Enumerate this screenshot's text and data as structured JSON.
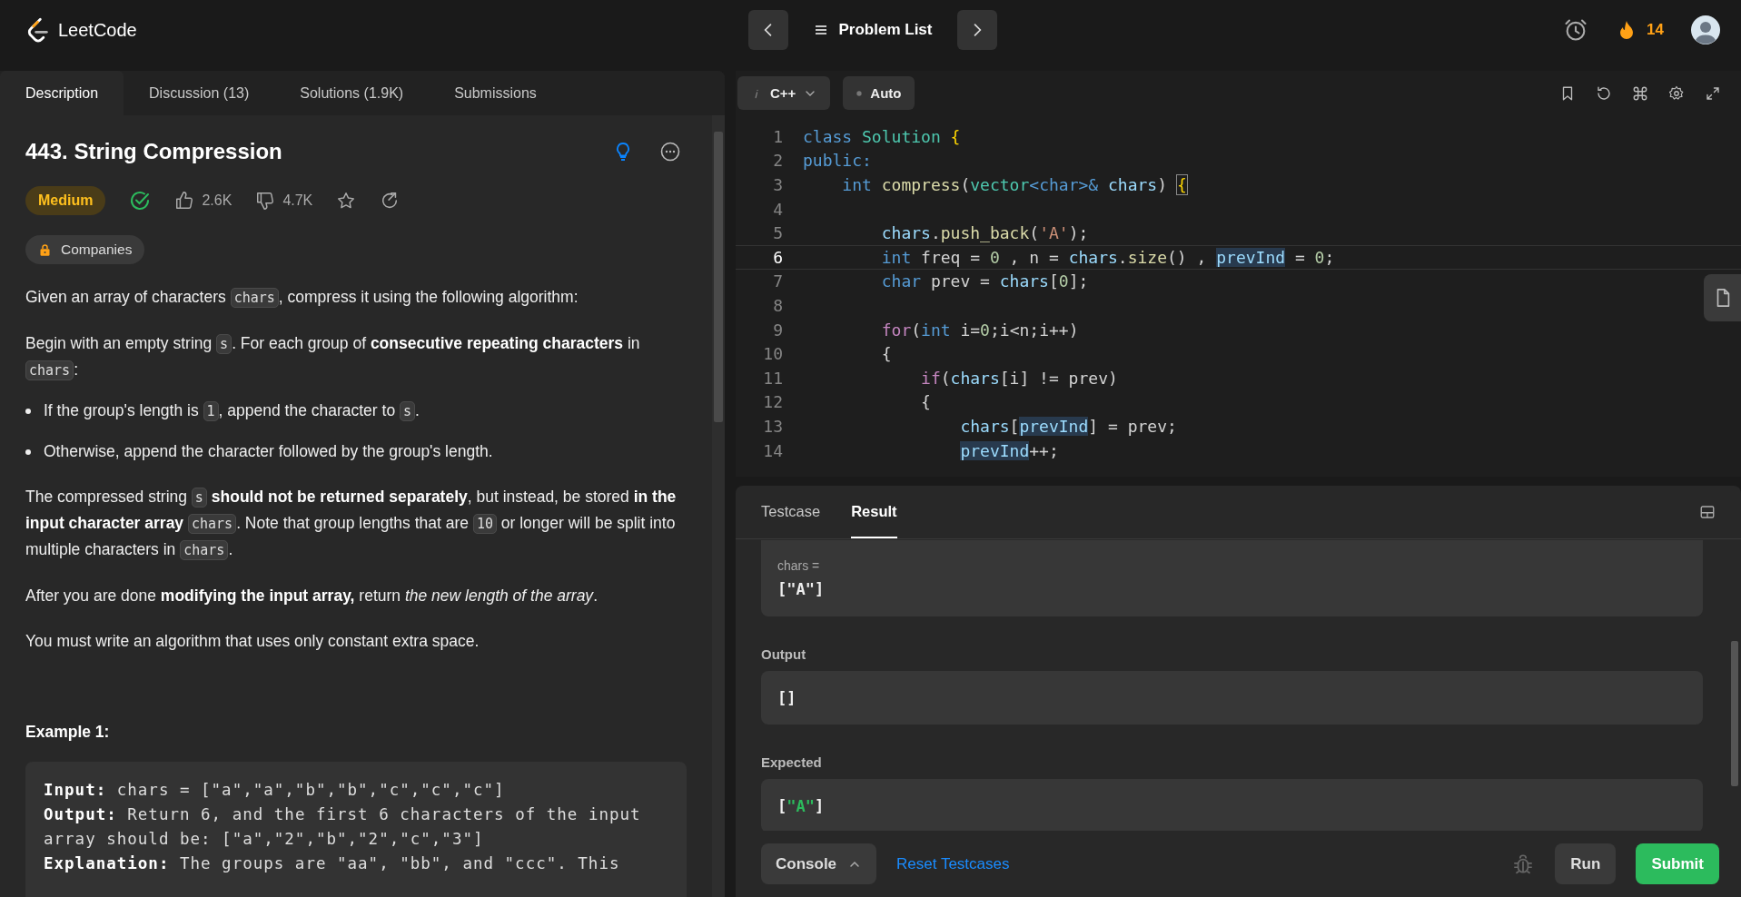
{
  "top_bar": {
    "logo": "LeetCode",
    "problem_list": "Problem List",
    "streak": "14"
  },
  "tabs": [
    {
      "label": "Description",
      "selected": true
    },
    {
      "label": "Discussion (13)",
      "selected": false
    },
    {
      "label": "Solutions (1.9K)",
      "selected": false
    },
    {
      "label": "Submissions",
      "selected": false
    }
  ],
  "problem": {
    "title": "443. String Compression",
    "difficulty": "Medium",
    "solved": true,
    "likes": "2.6K",
    "dislikes": "4.7K",
    "companies": "Companies",
    "description": [
      {
        "kind": "paragraph",
        "parts": [
          {
            "kind": "text",
            "text": "Given an array of characters "
          },
          {
            "kind": "code",
            "text": "chars"
          },
          {
            "kind": "text",
            "text": ", compress it using the following algorithm:"
          }
        ]
      },
      {
        "kind": "paragraph",
        "parts": [
          {
            "kind": "text",
            "text": "Begin with an empty string "
          },
          {
            "kind": "code",
            "text": "s"
          },
          {
            "kind": "text",
            "text": ". For each group of **consecutive repeating characters** in "
          },
          {
            "kind": "code",
            "text": "chars"
          },
          {
            "kind": "text",
            "text": ":"
          }
        ]
      },
      {
        "kind": "bullet",
        "parts": [
          {
            "kind": "text",
            "text": "If the group's length is "
          },
          {
            "kind": "code",
            "text": "1"
          },
          {
            "kind": "text",
            "text": ", append the character to "
          },
          {
            "kind": "code",
            "text": "s"
          },
          {
            "kind": "text",
            "text": "."
          }
        ]
      },
      {
        "kind": "bullet",
        "parts": [
          {
            "kind": "text",
            "text": "Otherwise, append the character followed by the group's length."
          }
        ]
      },
      {
        "kind": "paragraph",
        "parts": [
          {
            "kind": "text",
            "text": "The compressed string "
          },
          {
            "kind": "code",
            "text": "s"
          },
          {
            "kind": "text",
            "text": " **should not be returned separately**, but instead, be stored **in the input character array** "
          },
          {
            "kind": "code",
            "text": "chars"
          },
          {
            "kind": "text",
            "text": ". Note that group lengths that are "
          },
          {
            "kind": "code",
            "text": "10"
          },
          {
            "kind": "text",
            "text": " or longer will be split into multiple characters in "
          },
          {
            "kind": "code",
            "text": "chars"
          },
          {
            "kind": "text",
            "text": "."
          }
        ]
      },
      {
        "kind": "paragraph",
        "parts": [
          {
            "kind": "text",
            "text": "After you are done **modifying the input array,** return *the new length of the array*."
          }
        ]
      },
      {
        "kind": "paragraph",
        "parts": [
          {
            "kind": "text",
            "text": "You must write an algorithm that uses only constant extra space."
          }
        ]
      },
      {
        "kind": "heading",
        "parts": [
          {
            "kind": "text",
            "text": "Example 1:"
          }
        ]
      }
    ],
    "example": [
      "**Input:** chars = [\"a\",\"a\",\"b\",\"b\",\"c\",\"c\",\"c\"]",
      "**Output:** Return 6, and the first 6 characters of the input array should be: [\"a\",\"2\",\"b\",\"2\",\"c\",\"3\"]",
      "**Explanation:** The groups are \"aa\", \"bb\", and \"ccc\". This"
    ]
  },
  "editor": {
    "language": "C++",
    "mode": "Auto",
    "lines": [
      {
        "number": "1",
        "active": false,
        "tokens": [
          {
            "kind": "keyword",
            "text": "class "
          },
          {
            "kind": "type",
            "text": "Solution "
          },
          {
            "kind": "brace",
            "text": "{"
          }
        ]
      },
      {
        "number": "2",
        "active": false,
        "tokens": [
          {
            "kind": "keyword",
            "text": "public:"
          }
        ]
      },
      {
        "number": "3",
        "active": false,
        "tokens": [
          {
            "kind": "keyword",
            "text": "    int "
          },
          {
            "kind": "function",
            "text": "compress"
          },
          {
            "kind": "plain",
            "text": "("
          },
          {
            "kind": "type",
            "text": "vector"
          },
          {
            "kind": "keyword",
            "text": "<char>&"
          },
          {
            "kind": "variable",
            "text": " chars"
          },
          {
            "kind": "plain",
            "text": ") "
          },
          {
            "kind": "matched-brace",
            "text": "{"
          }
        ]
      },
      {
        "number": "4",
        "active": false
      },
      {
        "number": "5",
        "active": false,
        "tokens": [
          {
            "kind": "variable",
            "text": "        chars"
          },
          {
            "kind": "plain",
            "text": "."
          },
          {
            "kind": "function",
            "text": "push_back"
          },
          {
            "kind": "plain",
            "text": "("
          },
          {
            "kind": "string",
            "text": "'A'"
          },
          {
            "kind": "plain",
            "text": ");"
          }
        ]
      },
      {
        "number": "6",
        "active": true,
        "tokens": [
          {
            "kind": "keyword",
            "text": "        int"
          },
          {
            "kind": "plain",
            "text": " freq = "
          },
          {
            "kind": "number",
            "text": "0"
          },
          {
            "kind": "plain",
            "text": " , n = "
          },
          {
            "kind": "variable",
            "text": "chars"
          },
          {
            "kind": "plain",
            "text": "."
          },
          {
            "kind": "function",
            "text": "size"
          },
          {
            "kind": "plain",
            "text": "() , "
          },
          {
            "kind": "occurrence",
            "text": "prevInd"
          },
          {
            "kind": "plain",
            "text": " = "
          },
          {
            "kind": "number",
            "text": "0"
          },
          {
            "kind": "plain",
            "text": ";"
          }
        ]
      },
      {
        "number": "7",
        "active": false,
        "tokens": [
          {
            "kind": "keyword",
            "text": "        char"
          },
          {
            "kind": "plain",
            "text": " prev = "
          },
          {
            "kind": "variable",
            "text": "chars"
          },
          {
            "kind": "plain",
            "text": "["
          },
          {
            "kind": "number",
            "text": "0"
          },
          {
            "kind": "plain",
            "text": "];"
          }
        ]
      },
      {
        "number": "8",
        "active": false
      },
      {
        "number": "9",
        "active": false,
        "tokens": [
          {
            "kind": "control",
            "text": "        for"
          },
          {
            "kind": "plain",
            "text": "("
          },
          {
            "kind": "keyword",
            "text": "int"
          },
          {
            "kind": "plain",
            "text": " i="
          },
          {
            "kind": "number",
            "text": "0"
          },
          {
            "kind": "plain",
            "text": ";i<n;i++)"
          }
        ]
      },
      {
        "number": "10",
        "active": false,
        "tokens": [
          {
            "kind": "plain",
            "text": "        {"
          }
        ]
      },
      {
        "number": "11",
        "active": false,
        "tokens": [
          {
            "kind": "control",
            "text": "            if"
          },
          {
            "kind": "plain",
            "text": "("
          },
          {
            "kind": "variable",
            "text": "chars"
          },
          {
            "kind": "plain",
            "text": "[i] != prev)"
          }
        ]
      },
      {
        "number": "12",
        "active": false,
        "tokens": [
          {
            "kind": "plain",
            "text": "            {"
          }
        ]
      },
      {
        "number": "13",
        "active": false,
        "tokens": [
          {
            "kind": "variable",
            "text": "                chars"
          },
          {
            "kind": "plain",
            "text": "["
          },
          {
            "kind": "occurrence",
            "text": "prevInd"
          },
          {
            "kind": "plain",
            "text": "] = prev;"
          }
        ]
      },
      {
        "number": "14",
        "active": false,
        "tokens": [
          {
            "kind": "occurrence",
            "text": "                prevInd"
          },
          {
            "kind": "plain",
            "text": "++;"
          }
        ]
      }
    ]
  },
  "console": {
    "tabs": [
      {
        "label": "Testcase",
        "selected": false
      },
      {
        "label": "Result",
        "selected": true
      }
    ],
    "sections": [
      {
        "kind": "input",
        "label": "chars =",
        "value": [
          {
            "kind": "plain",
            "text": "[\"A\"]"
          }
        ]
      },
      {
        "kind": "output",
        "label": "Output",
        "value": [
          {
            "kind": "plain",
            "text": "[]"
          }
        ]
      },
      {
        "kind": "expected",
        "label": "Expected",
        "value": [
          {
            "kind": "plain",
            "text": "["
          },
          {
            "kind": "match",
            "text": "\"A\""
          },
          {
            "kind": "plain",
            "text": "]"
          }
        ]
      }
    ],
    "console_button": "Console",
    "reset_link": "Reset Testcases",
    "run_button": "Run",
    "submit_button": "Submit"
  }
}
